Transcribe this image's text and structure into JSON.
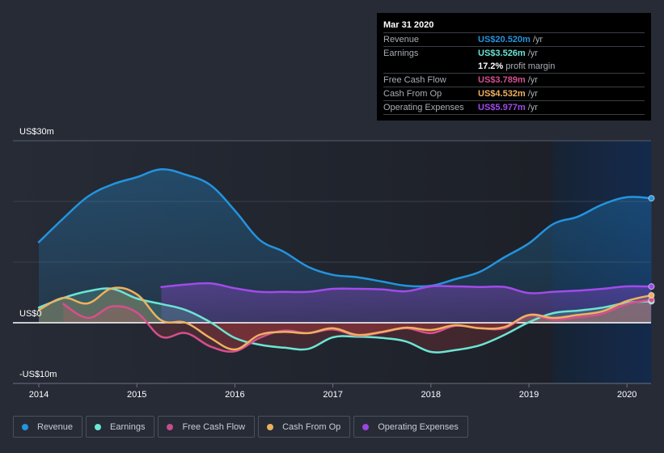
{
  "tooltip": {
    "date": "Mar 31 2020",
    "rows": [
      {
        "label": "Revenue",
        "value": "US$20.520m",
        "unit": "/yr",
        "color": "#2394df"
      },
      {
        "label": "Earnings",
        "value": "US$3.526m",
        "unit": "/yr",
        "color": "#6ce5d4"
      },
      {
        "label": "",
        "value": "17.2%",
        "unit": "profit margin",
        "color": "#ffffff"
      },
      {
        "label": "Free Cash Flow",
        "value": "US$3.789m",
        "unit": "/yr",
        "color": "#d64f8e"
      },
      {
        "label": "Cash From Op",
        "value": "US$4.532m",
        "unit": "/yr",
        "color": "#efb15f"
      },
      {
        "label": "Operating Expenses",
        "value": "US$5.977m",
        "unit": "/yr",
        "color": "#a24bea"
      }
    ]
  },
  "legend": [
    {
      "label": "Revenue",
      "color": "#2394df"
    },
    {
      "label": "Earnings",
      "color": "#6ce5d4"
    },
    {
      "label": "Free Cash Flow",
      "color": "#c64c8c"
    },
    {
      "label": "Cash From Op",
      "color": "#e9b05f"
    },
    {
      "label": "Operating Expenses",
      "color": "#9c45e0"
    }
  ],
  "chart_data": {
    "type": "line",
    "title": "",
    "xlabel": "",
    "ylabel": "",
    "unit": "US$ millions",
    "ylim": [
      -10,
      30
    ],
    "xlim": [
      2013.72,
      2020.25
    ],
    "y_ticks": [
      {
        "value": 30,
        "label": "US$30m"
      },
      {
        "value": 0,
        "label": "US$0"
      },
      {
        "value": -10,
        "label": "-US$10m"
      }
    ],
    "gridlines_at": [
      30,
      20,
      10
    ],
    "x_ticks": [
      {
        "value": 2014,
        "label": "2014"
      },
      {
        "value": 2015,
        "label": "2015"
      },
      {
        "value": 2016,
        "label": "2016"
      },
      {
        "value": 2017,
        "label": "2017"
      },
      {
        "value": 2018,
        "label": "2018"
      },
      {
        "value": 2019,
        "label": "2019"
      },
      {
        "value": 2020,
        "label": "2020"
      }
    ],
    "highlight_region": {
      "from": 2019.24,
      "to": 2020.25
    },
    "legend_position": "bottom",
    "series": [
      {
        "name": "Revenue",
        "color": "#2394df",
        "fill": "#2a5a86",
        "x": [
          2014.0,
          2014.25,
          2014.5,
          2014.75,
          2015.0,
          2015.25,
          2015.5,
          2015.75,
          2016.0,
          2016.25,
          2016.5,
          2016.75,
          2017.0,
          2017.25,
          2017.5,
          2017.75,
          2018.0,
          2018.25,
          2018.5,
          2018.75,
          2019.0,
          2019.25,
          2019.5,
          2019.75,
          2020.0,
          2020.25
        ],
        "values": [
          13.3,
          17.2,
          20.8,
          22.8,
          24.0,
          25.3,
          24.4,
          22.7,
          18.5,
          13.7,
          11.7,
          9.2,
          7.9,
          7.5,
          6.8,
          6.1,
          6.1,
          7.2,
          8.4,
          10.8,
          13.1,
          16.3,
          17.5,
          19.5,
          20.7,
          20.52
        ]
      },
      {
        "name": "Operating Expenses",
        "color": "#a24bea",
        "fill": "#4f3a8a",
        "x": [
          2015.25,
          2015.5,
          2015.75,
          2016.0,
          2016.25,
          2016.5,
          2016.75,
          2017.0,
          2017.25,
          2017.5,
          2017.75,
          2018.0,
          2018.25,
          2018.5,
          2018.75,
          2019.0,
          2019.25,
          2019.5,
          2019.75,
          2020.0,
          2020.25
        ],
        "values": [
          5.9,
          6.3,
          6.5,
          5.7,
          5.1,
          5.1,
          5.1,
          5.6,
          5.6,
          5.5,
          5.2,
          6.0,
          6.0,
          5.9,
          5.9,
          4.9,
          5.1,
          5.3,
          5.6,
          6.0,
          5.977
        ]
      },
      {
        "name": "Earnings",
        "color": "#6ce5d4",
        "fill": "#5fb3a5",
        "x": [
          2014.0,
          2014.25,
          2014.5,
          2014.75,
          2015.0,
          2015.25,
          2015.5,
          2015.75,
          2016.0,
          2016.25,
          2016.5,
          2016.75,
          2017.0,
          2017.25,
          2017.5,
          2017.75,
          2018.0,
          2018.25,
          2018.5,
          2018.75,
          2019.0,
          2019.25,
          2019.5,
          2019.75,
          2020.0,
          2020.25
        ],
        "values": [
          2.5,
          4.1,
          5.2,
          5.6,
          4.0,
          3.1,
          2.1,
          0.1,
          -2.5,
          -3.6,
          -4.1,
          -4.3,
          -2.4,
          -2.3,
          -2.5,
          -3.1,
          -4.8,
          -4.5,
          -3.7,
          -2.0,
          0.1,
          1.6,
          2.0,
          2.5,
          3.3,
          3.526
        ]
      },
      {
        "name": "Free Cash Flow",
        "color": "#d64f8e",
        "fill": "#b8486f",
        "x": [
          2014.25,
          2014.5,
          2014.75,
          2015.0,
          2015.25,
          2015.5,
          2015.75,
          2016.0,
          2016.25,
          2016.5,
          2016.75,
          2017.0,
          2017.25,
          2017.5,
          2017.75,
          2018.0,
          2018.25,
          2018.5,
          2018.75,
          2019.0,
          2019.25,
          2019.5,
          2019.75,
          2020.0,
          2020.25
        ],
        "values": [
          3.1,
          0.8,
          2.7,
          1.7,
          -2.3,
          -1.7,
          -3.9,
          -4.7,
          -2.5,
          -1.3,
          -1.7,
          -1.1,
          -2.1,
          -1.6,
          -0.9,
          -1.7,
          -0.5,
          -0.9,
          -0.9,
          1.2,
          0.5,
          0.9,
          1.5,
          3.1,
          3.789
        ]
      },
      {
        "name": "Cash From Op",
        "color": "#efb15f",
        "fill": "#c99a5a",
        "x": [
          2014.0,
          2014.25,
          2014.5,
          2014.75,
          2015.0,
          2015.25,
          2015.5,
          2015.75,
          2016.0,
          2016.25,
          2016.5,
          2016.75,
          2017.0,
          2017.25,
          2017.5,
          2017.75,
          2018.0,
          2018.25,
          2018.5,
          2018.75,
          2019.0,
          2019.25,
          2019.5,
          2019.75,
          2020.0,
          2020.25
        ],
        "values": [
          2.1,
          4.1,
          3.2,
          5.7,
          4.7,
          0.4,
          0.0,
          -2.5,
          -4.4,
          -2.0,
          -1.5,
          -1.7,
          -0.9,
          -2.0,
          -1.5,
          -0.8,
          -1.2,
          -0.4,
          -0.9,
          -0.7,
          1.3,
          0.8,
          1.3,
          1.9,
          3.6,
          4.532
        ]
      }
    ]
  }
}
